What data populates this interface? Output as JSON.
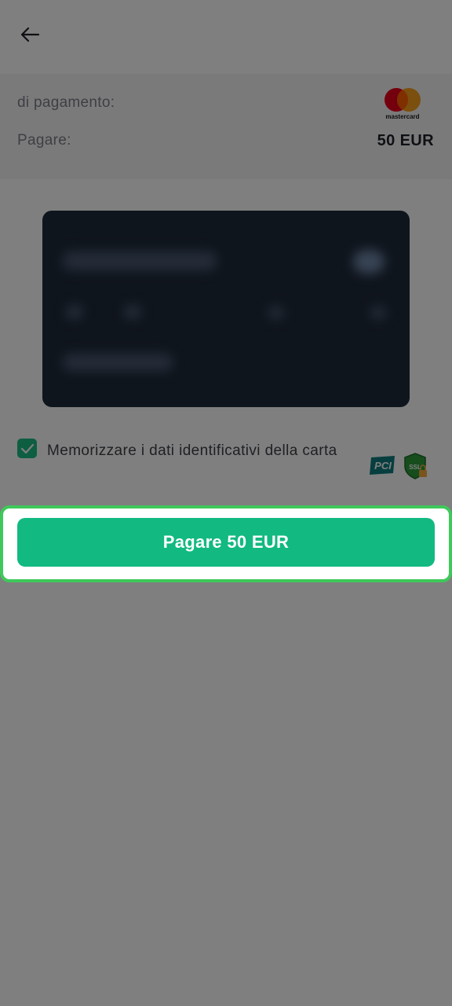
{
  "header": {
    "back_icon": "arrow-left-icon"
  },
  "summary": {
    "method_label": "di pagamento:",
    "card_brand": "mastercard",
    "pay_label": "Pagare:",
    "amount": "50 EUR"
  },
  "card_preview": {
    "state": "blurred"
  },
  "remember": {
    "checked": true,
    "label": "Memorizzare i dati identificativi della carta"
  },
  "badges": {
    "pci": "PCI",
    "ssl": "SSL"
  },
  "pay_button": {
    "label": "Pagare 50 EUR"
  },
  "colors": {
    "accent": "#12b981",
    "highlight_border": "#3ec95a"
  }
}
